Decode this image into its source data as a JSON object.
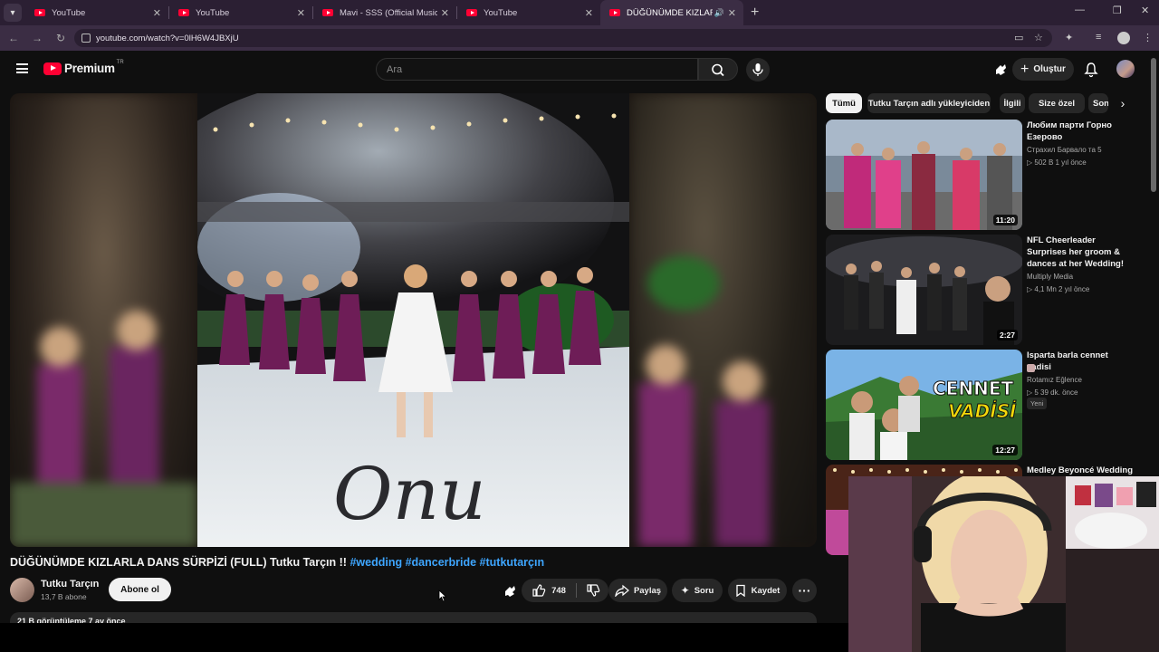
{
  "browser": {
    "tabs": [
      {
        "title": "YouTube",
        "active": false
      },
      {
        "title": "YouTube",
        "active": false
      },
      {
        "title": "Mavi - SSS (Official Music Video)",
        "active": false
      },
      {
        "title": "YouTube",
        "active": false
      },
      {
        "title": "DÜĞÜNÜMDE KIZLARLA DANS SÜRPİZİ",
        "active": true
      }
    ],
    "url": "youtube.com/watch?v=0lH6W4JBXjU"
  },
  "masthead": {
    "logo": "Premium",
    "country_code": "TR",
    "search_placeholder": "Ara",
    "create_label": "Oluştur"
  },
  "video": {
    "title": "DÜĞÜNÜMDE KIZLARLA DANS SÜRPİZİ (FULL) Tutku Tarçın !!",
    "tags": "#wedding #dancerbride #tutkutarçın",
    "channel": "Tutku Tarçın",
    "subscribers": "13,7 B abone",
    "subscribe_label": "Abone ol",
    "likes": "748",
    "share_label": "Paylaş",
    "ask_label": "Soru",
    "save_label": "Kaydet",
    "description_preview": "21 B görüntüleme  7 ay önce"
  },
  "chips": [
    "Tümü",
    "Tutku Tarçın adlı yükleyiciden",
    "İlgili",
    "Size özel",
    "Son"
  ],
  "recommendations": [
    {
      "title": "Любим парти Горно Езерово",
      "channel": "Страхил Барвало та 5",
      "meta": "▷ 502 B  1 yıl önce",
      "duration": "11:20"
    },
    {
      "title": "NFL Cheerleader Surprises her groom & dances at her Wedding!",
      "channel": "Multiply Media",
      "meta": "▷ 4,1 Mn  2 yıl önce",
      "duration": "2:27"
    },
    {
      "title": "Isparta barla cennet vadisi",
      "channel": "Rotamız Eğlence",
      "meta": "▷ 5  39 dk. önce",
      "duration": "12:27",
      "badge": "Yeni",
      "thumb_text": [
        "CENNET",
        "VADİSİ"
      ]
    },
    {
      "title": "Medley Beyoncé Wedding",
      "channel": "",
      "meta": "",
      "duration": ""
    }
  ],
  "overlay": {
    "floor_script": "Onu"
  }
}
